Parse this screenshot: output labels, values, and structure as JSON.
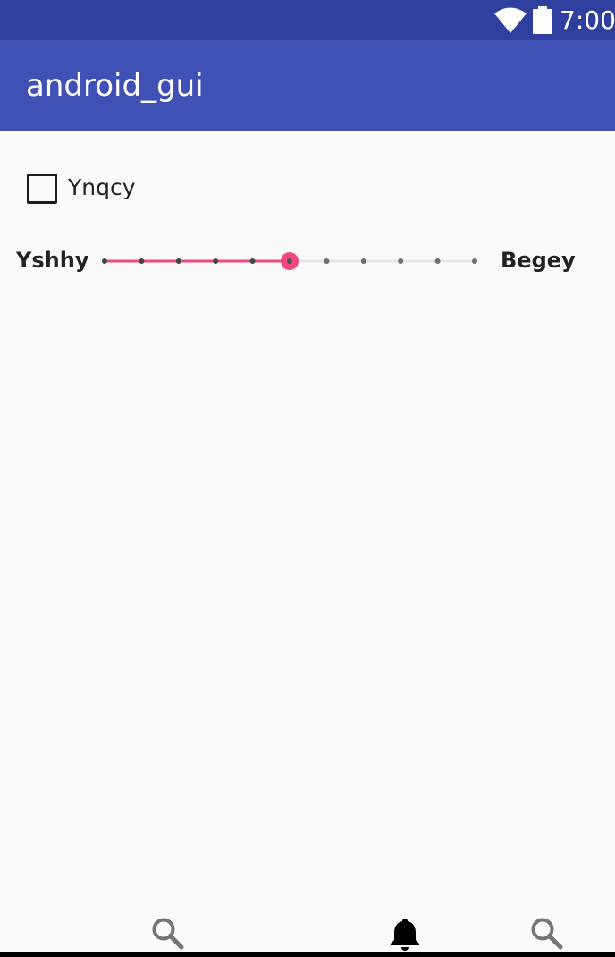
{
  "status_bar": {
    "time": "7:00",
    "icons": [
      "wifi-icon",
      "battery-icon"
    ]
  },
  "app_bar": {
    "title": "android_gui"
  },
  "checkbox": {
    "label": "Ynqcy",
    "checked": false
  },
  "slider": {
    "min_label": "Yshhy",
    "max_label": "Begey",
    "steps": 10,
    "value": 5
  },
  "bottom_nav": {
    "items": [
      "search-icon",
      "bell-icon",
      "search-icon"
    ]
  },
  "colors": {
    "status_bar": "#2f3f9e",
    "app_bar": "#3f51b5",
    "accent": "#ef4a7f",
    "background": "#fafafa"
  }
}
